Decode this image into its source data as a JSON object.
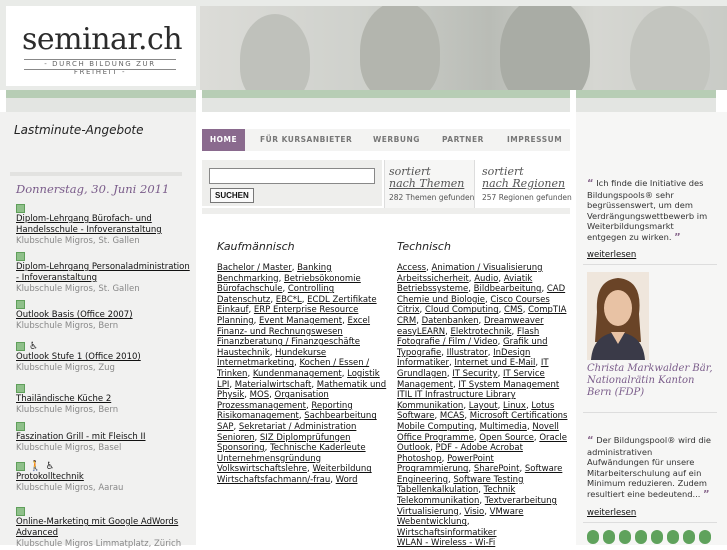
{
  "header": {
    "logo_text": "seminar.ch",
    "tagline": "- DURCH BILDUNG ZUR FREIHEIT -"
  },
  "nav": {
    "items": [
      "HOME",
      "FÜR KURSANBIETER",
      "WERBUNG",
      "PARTNER",
      "IMPRESSUM"
    ]
  },
  "search": {
    "value": "",
    "button_label": "SUCHEN"
  },
  "sorted": [
    {
      "title_line1": "sortiert",
      "title_line2": "nach Themen",
      "count": "282 Themen gefunden"
    },
    {
      "title_line1": "sortiert",
      "title_line2": "nach Regionen",
      "count": "257 Regionen gefunden"
    }
  ],
  "left": {
    "title": "Lastminute-Angebote",
    "date": "Donnerstag, 30. Juni 2011",
    "courses": [
      {
        "title": "Diplom-Lehrgang Bürofach- und Handelsschule - Infoveranstaltung",
        "school": "Klubschule Migros, St. Gallen",
        "icons": [
          "green-square"
        ]
      },
      {
        "title": "Diplom-Lehrgang Personaladministration - Infoveranstaltung",
        "school": "Klubschule Migros, St. Gallen",
        "icons": [
          "green-square"
        ]
      },
      {
        "title": "Outlook Basis (Office 2007)",
        "school": "Klubschule Migros, Bern",
        "icons": [
          "green-square"
        ]
      },
      {
        "title": "Outlook Stufe 1 (Office 2010)",
        "school": "Klubschule Migros, Zug",
        "icons": [
          "green-square",
          "wheelchair"
        ]
      },
      {
        "title": "Thailändische Küche 2",
        "school": "Klubschule Migros, Bern",
        "icons": [
          "green-square"
        ]
      },
      {
        "title": "Faszination Grill - mit Fleisch II",
        "school": "Klubschule Migros, Basel",
        "icons": [
          "green-square"
        ]
      },
      {
        "title": "Protokolltechnik",
        "school": "Klubschule Migros, Aarau",
        "icons": [
          "green-square",
          "person",
          "wheelchair"
        ]
      },
      {
        "title": "Online-Marketing mit Google AdWords Advanced",
        "school": "Klubschule Migros Limmatplatz, Zürich",
        "icons": [
          "green-square"
        ]
      }
    ]
  },
  "categories": {
    "kaufmaennisch": {
      "heading": "Kaufmännisch",
      "lines": [
        [
          "Bachelor / Master",
          "Banking"
        ],
        [
          "Benchmarking",
          "Betriebsökonomie"
        ],
        [
          "Bürofachschule",
          "Controlling"
        ],
        [
          "Datenschutz",
          "EBC*L",
          "ECDL Zertifikate"
        ],
        [
          "Einkauf",
          "ERP Enterprise Resource"
        ],
        [
          "Planning",
          "Event Management",
          "Excel"
        ],
        [
          "Finanz- und Rechnungswesen"
        ],
        [
          "Finanzberatung / Finanzgeschäfte"
        ],
        [
          "Haustechnik",
          "Hundekurse"
        ],
        [
          "Internetmarketing",
          "Kochen / Essen /"
        ],
        [
          "Trinken",
          "Kundenmanagement",
          "Logistik"
        ],
        [
          "LPI",
          "Materialwirtschaft",
          "Mathematik und"
        ],
        [
          "Physik",
          "MOS",
          "Organisation"
        ],
        [
          "Prozessmanagement",
          "Reporting"
        ],
        [
          "Risikomanagement",
          "Sachbearbeitung"
        ],
        [
          "SAP",
          "Sekretariat / Administration"
        ],
        [
          "Senioren",
          "SIZ Diplomprüfungen"
        ],
        [
          "Sponsoring",
          "Technische Kaderleute"
        ],
        [
          "Unternehmensgründung"
        ],
        [
          "Volkswirtschaftslehre",
          "Weiterbildung"
        ],
        [
          "Wirtschaftsfachmann/-frau",
          "Word"
        ]
      ]
    },
    "technisch": {
      "heading": "Technisch",
      "lines": [
        [
          "Access",
          "Animation / Visualisierung"
        ],
        [
          "Arbeitssicherheit",
          "Audio",
          "Aviatik"
        ],
        [
          "Betriebssysteme",
          "Bildbearbeitung",
          "CAD"
        ],
        [
          "Chemie und Biologie",
          "Cisco Courses"
        ],
        [
          "Citrix",
          "Cloud Computing",
          "CMS",
          "CompTIA"
        ],
        [
          "CRM",
          "Datenbanken",
          "Dreamweaver"
        ],
        [
          "easyLEARN",
          "Elektrotechnik",
          "Flash"
        ],
        [
          "Fotografie / Film / Video",
          "Grafik und"
        ],
        [
          "Typografie",
          "Illustrator",
          "InDesign"
        ],
        [
          "Informatiker",
          "Internet und E-Mail",
          "IT"
        ],
        [
          "Grundlagen",
          "IT Security",
          "IT Service"
        ],
        [
          "Management",
          "IT System Management"
        ],
        [
          "ITIL IT Infrastructure Library"
        ],
        [
          "Kommunikation",
          "Layout",
          "Linux",
          "Lotus"
        ],
        [
          "Software",
          "MCAS",
          "Microsoft Certifications"
        ],
        [
          "Mobile Computing",
          "Multimedia",
          "Novell"
        ],
        [
          "Office Programme",
          "Open Source",
          "Oracle"
        ],
        [
          "Outlook",
          "PDF - Adobe Acrobat"
        ],
        [
          "Photoshop",
          "PowerPoint"
        ],
        [
          "Programmierung",
          "SharePoint",
          "Software"
        ],
        [
          "Engineering",
          "Software Testing"
        ],
        [
          "Tabellenkalkulation",
          "Technik"
        ],
        [
          "Telekommunikation",
          "Textverarbeitung"
        ],
        [
          "Virtualisierung",
          "Visio",
          "VMware"
        ],
        [
          "Webentwicklung",
          "Wirtschaftsinformatiker"
        ],
        [
          "WLAN - Wireless - Wi-Fi"
        ]
      ]
    }
  },
  "right": {
    "quote1": "Ich finde die Initiative des Bildungspools® sehr begrüssenswert, um dem Verdrängungswettbewerb im Weiterbildungsmarkt entgegen zu wirken.",
    "more1": "weiterlesen",
    "caption": "Christa Markwalder Bär, Nationalrätin Kanton Bern (FDP)",
    "quote2": "Der Bildungspool® wird die administrativen Aufwändungen für unsere Mitarbeiterschulung auf ein Minimum reduzieren. Zudem resultiert eine bedeutend...",
    "more2": "weiterlesen"
  },
  "colors": {
    "accent_purple": "#8a6a8e",
    "accent_green": "#b7cdb5",
    "date_color": "#7a5c8a"
  }
}
